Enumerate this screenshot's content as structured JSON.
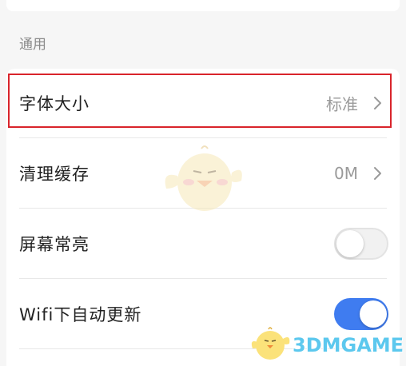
{
  "section": {
    "title": "通用"
  },
  "rows": [
    {
      "label": "字体大小",
      "value": "标准",
      "icon": "chevron-right-icon"
    },
    {
      "label": "清理缓存",
      "value": "0M",
      "icon": "chevron-right-icon"
    },
    {
      "label": "屏幕常亮",
      "toggle_on": false
    },
    {
      "label": "Wifi下自动更新",
      "toggle_on": true
    }
  ],
  "colors": {
    "highlight_border": "#d9242b",
    "toggle_on": "#3f7cf0",
    "watermark": "#5cc8ee"
  },
  "watermark": {
    "text": "3DMGAME",
    "icon": "mascot-chick-icon"
  }
}
